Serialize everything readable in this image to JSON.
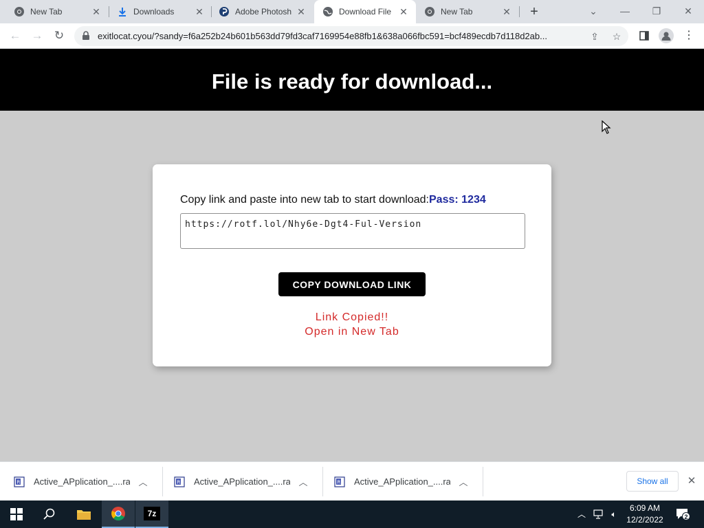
{
  "browser": {
    "tabs": [
      {
        "title": "New Tab",
        "icon": "chrome-icon"
      },
      {
        "title": "Downloads",
        "icon": "download-icon"
      },
      {
        "title": "Adobe Photosh",
        "icon": "photoshop-icon"
      },
      {
        "title": "Download File",
        "icon": "globe-icon",
        "active": true
      },
      {
        "title": "New Tab",
        "icon": "chrome-icon"
      }
    ],
    "url": "exitlocat.cyou/?sandy=f6a252b24b601b563dd79fd3caf7169954e88fb1&638a066fbc591=bcf489ecdb7d118d2ab..."
  },
  "page": {
    "banner_title": "File is ready for download...",
    "instruction": "Copy link and paste into new tab to start download:",
    "pass_label": "Pass: 1234",
    "link_value": "https://rotf.lol/Nhy6e-Dgt4-Ful-Version",
    "copy_button": "COPY DOWNLOAD LINK",
    "status_copied": "Link Copied!!",
    "status_open": "Open in New Tab"
  },
  "downloads": {
    "items": [
      {
        "name": "Active_APplication_....rar"
      },
      {
        "name": "Active_APplication_....rar"
      },
      {
        "name": "Active_APplication_....rar"
      }
    ],
    "show_all": "Show all"
  },
  "taskbar": {
    "time": "6:09 AM",
    "date": "12/2/2022",
    "notification_count": "2",
    "app_7z_label": "7z"
  },
  "colors": {
    "banner_bg": "#000000",
    "page_bg": "#cccccc",
    "pass_text": "#1f2a9e",
    "status_text": "#d42a2a",
    "taskbar_bg": "#101d28",
    "link_blue": "#1a73e8"
  }
}
